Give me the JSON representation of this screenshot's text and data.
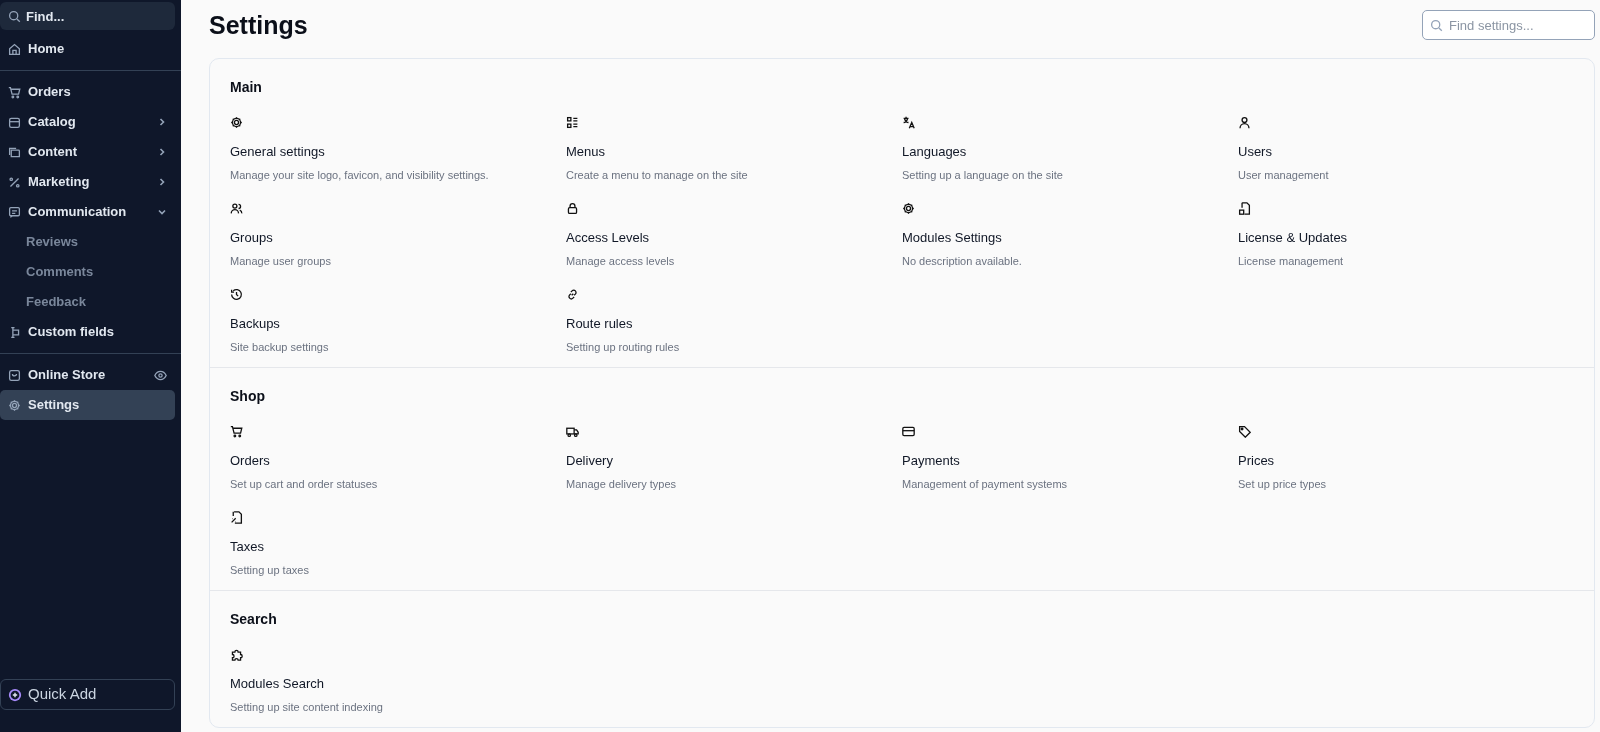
{
  "sidebar": {
    "search": {
      "placeholder": "Find..."
    },
    "groups": [
      [
        {
          "label": "Home",
          "selected": false
        }
      ],
      [
        {
          "label": "Orders",
          "selected": false
        },
        {
          "label": "Catalog",
          "selected": false,
          "expanded": false
        },
        {
          "label": "Content",
          "selected": false,
          "expanded": false
        },
        {
          "label": "Marketing",
          "selected": false,
          "expanded": false
        },
        {
          "label": "Communication",
          "selected": false,
          "expanded": true,
          "children": [
            {
              "label": "Reviews",
              "selected": false
            },
            {
              "label": "Comments",
              "selected": false
            },
            {
              "label": "Feedback",
              "selected": false
            }
          ]
        },
        {
          "label": "Custom fields",
          "selected": false
        }
      ],
      [
        {
          "label": "Online Store",
          "selected": false,
          "kind": "preview"
        },
        {
          "label": "Settings",
          "selected": true
        }
      ]
    ],
    "quick_add": "Quick Add"
  },
  "page": {
    "title": "Settings",
    "search": {
      "placeholder": "Find settings..."
    }
  },
  "sections": [
    {
      "title": "Main",
      "items": [
        {
          "title": "General settings",
          "description": "Manage your site logo, favicon, and visibility settings."
        },
        {
          "title": "Menus",
          "description": "Create a menu to manage on the site"
        },
        {
          "title": "Languages",
          "description": "Setting up a language on the site"
        },
        {
          "title": "Users",
          "description": "User management"
        },
        {
          "title": "Groups",
          "description": "Manage user groups"
        },
        {
          "title": "Access Levels",
          "description": "Manage access levels"
        },
        {
          "title": "Modules Settings",
          "description": "No description available."
        },
        {
          "title": "License & Updates",
          "description": "License management"
        },
        {
          "title": "Backups",
          "description": "Site backup settings"
        },
        {
          "title": "Route rules",
          "description": "Setting up routing rules"
        }
      ]
    },
    {
      "title": "Shop",
      "items": [
        {
          "title": "Orders",
          "description": "Set up cart and order statuses"
        },
        {
          "title": "Delivery",
          "description": "Manage delivery types"
        },
        {
          "title": "Payments",
          "description": "Management of payment systems"
        },
        {
          "title": "Prices",
          "description": "Set up price types"
        },
        {
          "title": "Taxes",
          "description": "Setting up taxes"
        }
      ]
    },
    {
      "title": "Search",
      "items": [
        {
          "title": "Modules Search",
          "description": "Setting up site content indexing"
        }
      ]
    }
  ]
}
